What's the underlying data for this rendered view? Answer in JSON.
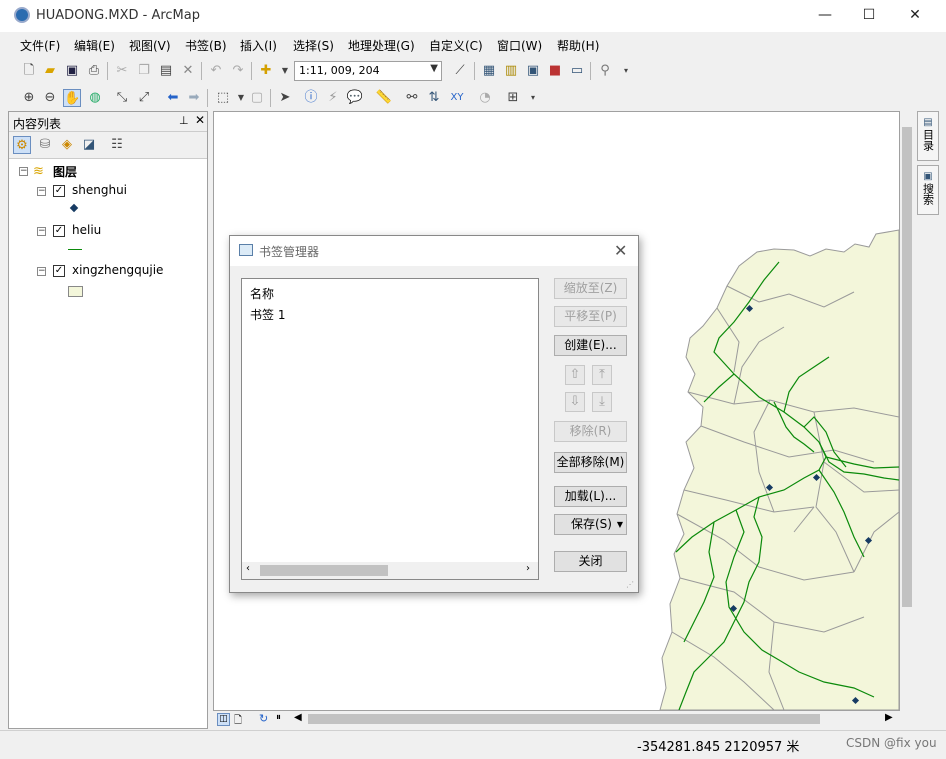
{
  "window": {
    "title": "HUADONG.MXD - ArcMap",
    "minimize": "—",
    "maximize": "☐",
    "close": "✕"
  },
  "menu": [
    "文件(F)",
    "编辑(E)",
    "视图(V)",
    "书签(B)",
    "插入(I)",
    "选择(S)",
    "地理处理(G)",
    "自定义(C)",
    "窗口(W)",
    "帮助(H)"
  ],
  "toolbar": {
    "scale": "1:11, 009, 204"
  },
  "toc": {
    "title": "内容列表",
    "root": "图层",
    "layers": [
      {
        "name": "shenghui",
        "checked": true
      },
      {
        "name": "heliu",
        "checked": true
      },
      {
        "name": "xingzhengqujie",
        "checked": true
      }
    ]
  },
  "dock_tabs": [
    "目录",
    "搜索"
  ],
  "status": {
    "coords": "-354281.845  2120957 米",
    "watermark": "CSDN @fix you"
  },
  "dialog": {
    "title": "书签管理器",
    "list_header": "名称",
    "bookmarks": [
      "书签 1"
    ],
    "buttons": {
      "zoom_to": "缩放至(Z)",
      "pan_to": "平移至(P)",
      "create": "创建(E)...",
      "remove": "移除(R)",
      "remove_all": "全部移除(M)",
      "load": "加载(L)...",
      "save": "保存(S)",
      "close": "关闭"
    }
  },
  "colors": {
    "land": "#f3f6da",
    "river": "#0b8a0b",
    "boundary": "#9a9a9a",
    "point": "#173b63"
  }
}
